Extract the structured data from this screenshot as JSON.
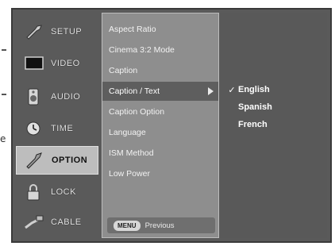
{
  "nav": {
    "items": [
      {
        "label": "SETUP",
        "icon": "wrench-icon"
      },
      {
        "label": "VIDEO",
        "icon": "monitor-icon"
      },
      {
        "label": "AUDIO",
        "icon": "speaker-icon"
      },
      {
        "label": "TIME",
        "icon": "clock-icon"
      },
      {
        "label": "OPTION",
        "icon": "tool-icon"
      },
      {
        "label": "LOCK",
        "icon": "lock-icon"
      },
      {
        "label": "CABLE",
        "icon": "cable-icon"
      }
    ],
    "active_index": 4
  },
  "menu": {
    "items": [
      {
        "label": "Aspect Ratio"
      },
      {
        "label": "Cinema 3:2 Mode"
      },
      {
        "label": "Caption"
      },
      {
        "label": "Caption / Text"
      },
      {
        "label": "Caption Option"
      },
      {
        "label": "Language"
      },
      {
        "label": "ISM Method"
      },
      {
        "label": "Low Power"
      }
    ],
    "active_index": 3,
    "footer_key": "MENU",
    "footer_text": "Previous"
  },
  "submenu": {
    "items": [
      {
        "label": "English",
        "selected": true
      },
      {
        "label": "Spanish",
        "selected": false
      },
      {
        "label": "French",
        "selected": false
      }
    ]
  },
  "edge_glyph": "e",
  "colors": {
    "screen_bg": "#5a5a5a",
    "menu_bg": "#8e8e8e",
    "active_nav_bg": "#bdbdbd",
    "active_menu_bg": "#5e5e5e"
  }
}
